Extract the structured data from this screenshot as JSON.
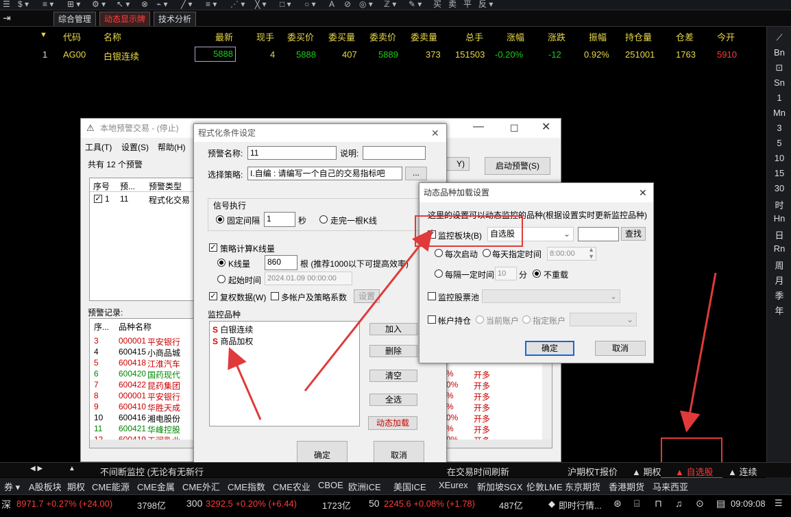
{
  "toolbar": {
    "items": [
      "☰",
      "$ ▾",
      "≡ ▾",
      "⊞ ▾",
      "⚙ ▾",
      "↖ ▾",
      "⊗",
      "⌁ ▾",
      "╱ ▾",
      "≡ ▾",
      "⋰ ▾",
      "╳ ▾",
      "□ ▾",
      "○ ▾",
      "A",
      "⊘",
      "◎ ▾",
      "ℤ ▾",
      "✎ ▾",
      "买",
      "卖",
      "平",
      "反 ▾"
    ]
  },
  "tabs": [
    "综合管理",
    "动态显示牌",
    "技术分析"
  ],
  "quote_header": [
    "代码",
    "名称",
    "最新",
    "现手",
    "委买价",
    "委买量",
    "委卖价",
    "委卖量",
    "总手",
    "涨幅",
    "涨跌",
    "振幅",
    "持仓量",
    "仓差",
    "今开"
  ],
  "quote_row": {
    "idx": "1",
    "code": "AG00",
    "name": "白银连续",
    "last": "5888",
    "vol": "4",
    "bid": "5888",
    "bidq": "407",
    "ask": "5889",
    "askq": "373",
    "total": "151503",
    "chg_pct": "-0.20%",
    "chg": "-12",
    "amp": "0.92%",
    "oi": "251001",
    "oid": "1763",
    "open": "5910"
  },
  "right_sidebar": [
    "⟋",
    "Bn",
    "⊡",
    "Sn",
    "1",
    "Mn",
    "3",
    "5",
    "10",
    "15",
    "30",
    "时",
    "Hn",
    "日",
    "Rn",
    "周",
    "月",
    "季",
    "年"
  ],
  "alert_window": {
    "title": "本地预警交易 - (停止)",
    "menu": [
      "工具(T)",
      "设置(S)",
      "帮助(H)"
    ],
    "count": "共有 12 个预警",
    "start_btn": "启动预警(S)",
    "top_btn": "Y)",
    "list_headers": [
      "序号",
      "预...",
      "预警类型"
    ],
    "list_row": {
      "idx": "1",
      "code": "11",
      "type": "程式化交易"
    },
    "records_label": "预警记录:",
    "records_headers": [
      "序...",
      "品种名称"
    ],
    "records": [
      {
        "n": "3",
        "code": "000001",
        "name": "平安银行",
        "pct": "",
        "act": "",
        "color": "red"
      },
      {
        "n": "4",
        "code": "600415",
        "name": "小商品城",
        "pct": "",
        "act": "",
        "color": "black"
      },
      {
        "n": "5",
        "code": "600418",
        "name": "江淮汽车",
        "pct": "",
        "act": "",
        "color": "red"
      },
      {
        "n": "6",
        "code": "600420",
        "name": "国药现代",
        "pct": "%",
        "act": "开多",
        "color": "green"
      },
      {
        "n": "7",
        "code": "600422",
        "name": "昆药集团",
        "pct": "0%",
        "act": "开多",
        "color": "red"
      },
      {
        "n": "8",
        "code": "000001",
        "name": "平安银行",
        "pct": "%",
        "act": "开多",
        "color": "red"
      },
      {
        "n": "9",
        "code": "600410",
        "name": "华胜天成",
        "pct": "%",
        "act": "开多",
        "color": "red"
      },
      {
        "n": "10",
        "code": "600416",
        "name": "湘电股份",
        "pct": "0%",
        "act": "开多",
        "color": "black"
      },
      {
        "n": "11",
        "code": "600421",
        "name": "华峰控股",
        "pct": "%",
        "act": "开多",
        "color": "green"
      },
      {
        "n": "12",
        "code": "600419",
        "name": "天润乳业",
        "pct": "9%",
        "act": "开多",
        "color": "red"
      }
    ],
    "bottom_check": "不间断监控 (无论有无新行",
    "bottom_right": "在交易时间刷新"
  },
  "cond_window": {
    "title": "程式化条件设定",
    "name_label": "预警名称:",
    "name_value": "11",
    "desc_label": "说明:",
    "desc_value": "",
    "strategy_label": "选择策略:",
    "strategy_value": "I.自编 : 请编写一个自己的交易指标吧 ",
    "signal_group": "信号执行",
    "fixed_interval": "固定间隔",
    "interval_value": "1",
    "sec": "秒",
    "per_bar": "走完一根K线",
    "calc_check": "策略计算K线量",
    "kline": "K线量",
    "kline_value": "860",
    "kline_hint": "根 (推荐1000以下可提高效率)",
    "start_time": "起始时间",
    "start_value": "2024.01.09 00:00:00",
    "set_btn": "设置",
    "adj": "复权数据(W)",
    "multi": "多帐户及策略系数",
    "monitor_label": "监控品种",
    "monitor_items": [
      "白银连续",
      "商品加权"
    ],
    "btns": [
      "加入",
      "删除",
      "清空",
      "全选",
      "动态加载"
    ],
    "ok": "确定",
    "cancel": "取消"
  },
  "dyn_window": {
    "title": "动态品种加载设置",
    "desc": "这里的设置可以动态监控的品种(根据设置实时更新监控品种)",
    "monitor_block": "监控板块(B)",
    "block_value": "自选股",
    "find_btn": "查找",
    "each_start": "每次启动",
    "daily_time": "每天指定时间",
    "time_value": "8:00:00",
    "every": "每隔一定时间",
    "every_value": "10",
    "min": "分",
    "noreload": "不重载",
    "stock_pool": "监控股票池",
    "account": "帐户持仓",
    "cur_acct": "当前账户",
    "spec_acct": "指定账户",
    "ok": "确定",
    "cancel": "取消"
  },
  "bottom_tabs": [
    "沪期权T报价",
    "▲ 期权",
    "▲ 自选股",
    "▲ 连续"
  ],
  "market_bar": [
    "券 ▾",
    "A股板块",
    "期权",
    "CME能源",
    "CME金属",
    "CME外汇",
    "CME指数",
    "CME农业",
    "CBOE",
    "欧洲ICE",
    "美国ICE",
    "XEurex",
    "新加坡SGX",
    "伦敦LME",
    "东京期货",
    "香港期货",
    "马来西亚"
  ],
  "status": {
    "sh_label": "深",
    "sh_val": "8971.7 +0.27% (+24.00)",
    "sh_amt": "3798亿",
    "i300_label": "300",
    "i300_val": "3292.5 +0.20% (+6.44)",
    "i300_amt": "1723亿",
    "i50_label": "50",
    "i50_val": "2245.6 +0.08% (+1.78)",
    "i50_amt": "487亿",
    "news": "即时行情...",
    "clock": "09:09:08"
  }
}
